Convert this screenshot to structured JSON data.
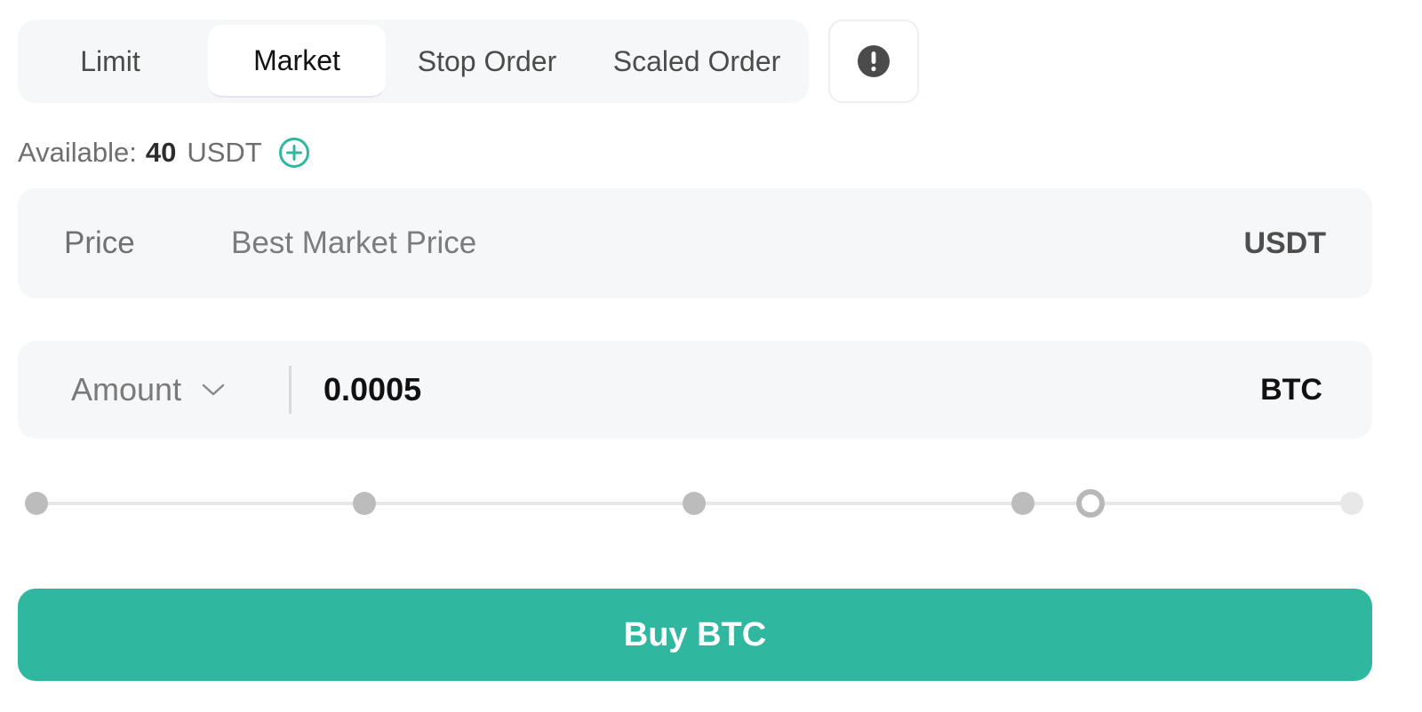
{
  "tabs": {
    "limit": "Limit",
    "market": "Market",
    "stop": "Stop Order",
    "scaled": "Scaled Order",
    "active": "Market"
  },
  "available": {
    "label": "Available:",
    "value": "40",
    "unit": "USDT"
  },
  "price": {
    "label": "Price",
    "value": "Best Market Price",
    "unit": "USDT"
  },
  "amount": {
    "selector_label": "Amount",
    "value": "0.0005",
    "unit": "BTC"
  },
  "slider": {
    "percent": 80
  },
  "buy_button": {
    "label": "Buy BTC"
  },
  "colors": {
    "accent": "#2fb89f",
    "panel": "#f6f7f9"
  },
  "icons": {
    "info": "exclamation-circle-icon",
    "add": "plus-circle-icon",
    "chevron": "chevron-down-icon"
  }
}
